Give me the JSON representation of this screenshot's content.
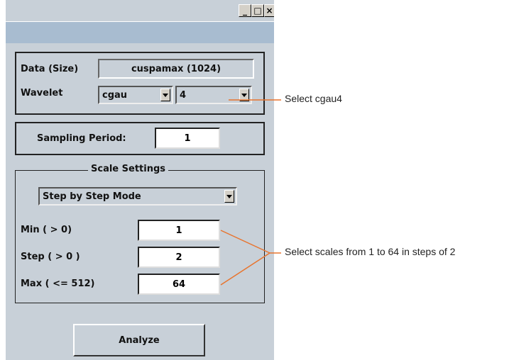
{
  "window": {
    "controls": {
      "minimize": "_",
      "maximize": "□",
      "close": "×"
    }
  },
  "data_size": {
    "label": "Data  (Size)",
    "value": "cuspamax  (1024)"
  },
  "wavelet": {
    "label": "Wavelet",
    "family": "cgau",
    "order": "4"
  },
  "sampling": {
    "label": "Sampling Period:",
    "value": "1"
  },
  "scale_settings": {
    "legend": "Scale Settings",
    "mode": "Step by Step Mode",
    "min": {
      "label": "Min  ( > 0)",
      "value": "1"
    },
    "step": {
      "label": "Step ( > 0 )",
      "value": "2"
    },
    "max": {
      "label": "Max  ( <= 512)",
      "value": "64"
    }
  },
  "analyze_button": "Analyze",
  "annotations": {
    "wavelet_note": "Select cgau4",
    "scales_note": "Select scales from 1 to 64 in steps of 2"
  },
  "colors": {
    "panel": "#c8d0d8",
    "menustrip": "#a8bcd0",
    "callout": "#e8742e"
  }
}
